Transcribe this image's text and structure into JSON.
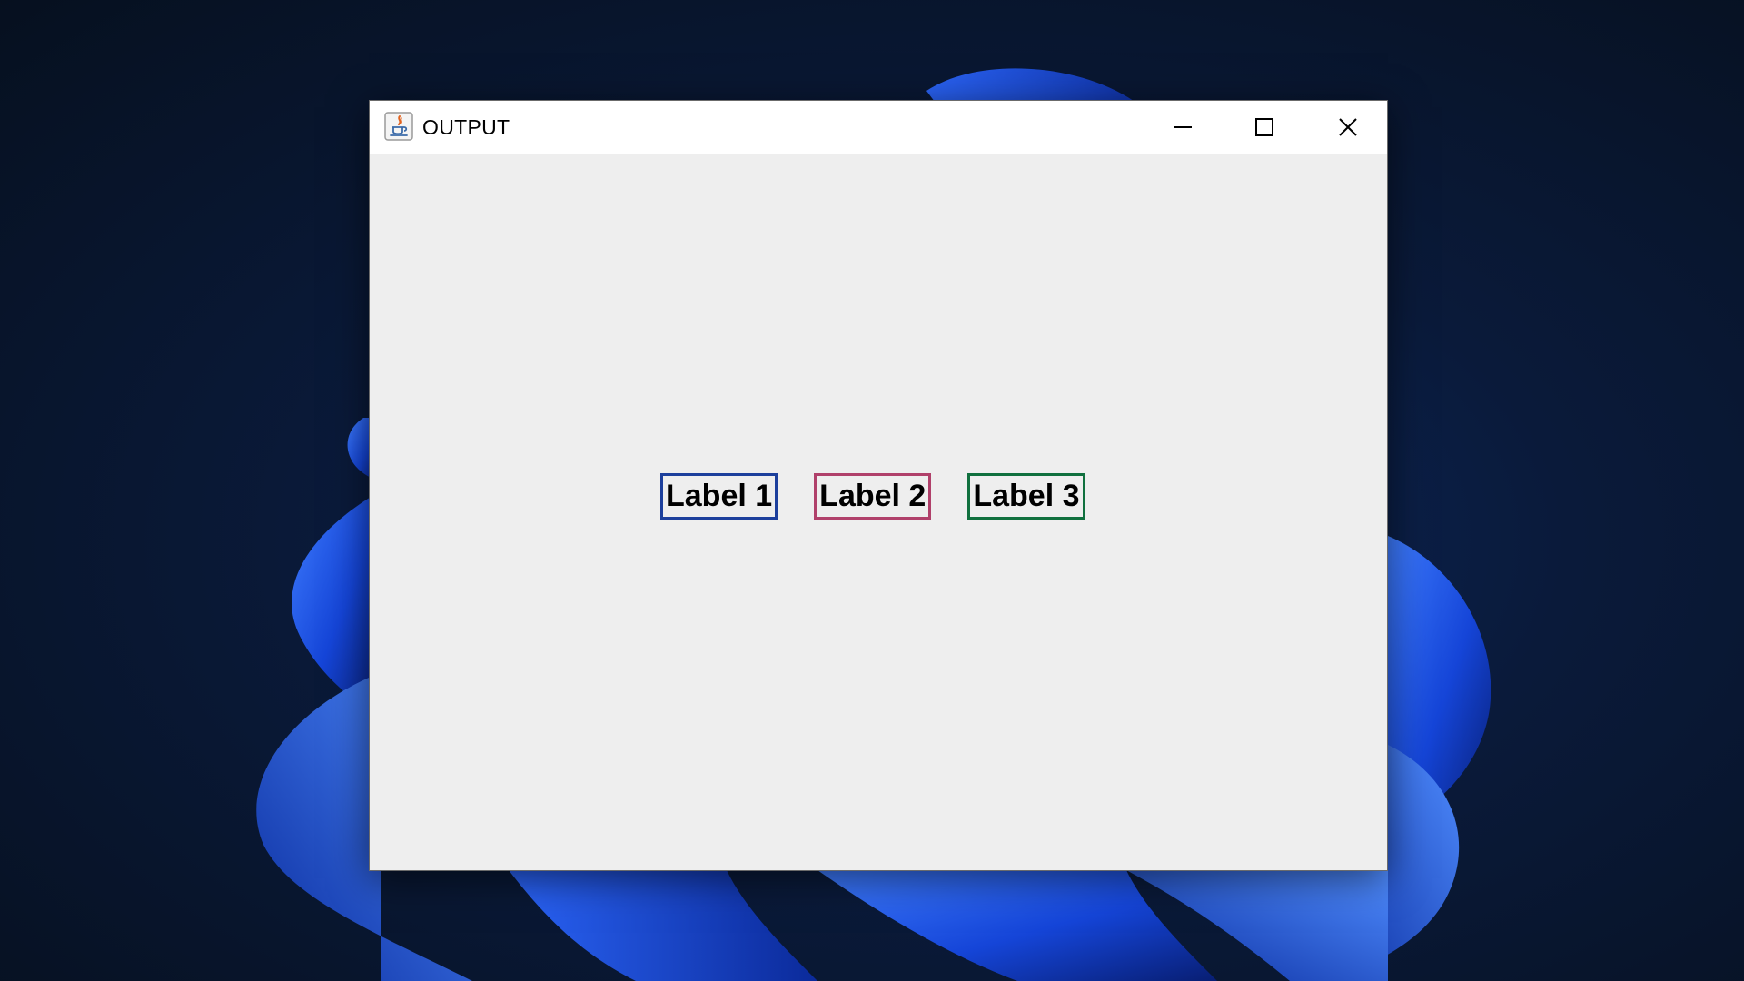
{
  "window": {
    "title": "OUTPUT",
    "app_icon": "java-icon",
    "controls": {
      "minimize_icon": "minimize-icon",
      "maximize_icon": "maximize-icon",
      "close_icon": "close-icon"
    }
  },
  "content": {
    "background_color": "#eeeeee",
    "labels": [
      {
        "text": "Label 1",
        "border_color": "#1c3f9c"
      },
      {
        "text": "Label 2",
        "border_color": "#b0406a"
      },
      {
        "text": "Label 3",
        "border_color": "#10703e"
      }
    ]
  }
}
